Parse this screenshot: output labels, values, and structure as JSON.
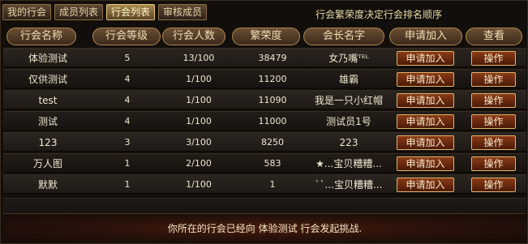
{
  "tabs": [
    {
      "label": "我的行会"
    },
    {
      "label": "成员列表"
    },
    {
      "label": "行会列表"
    },
    {
      "label": "审核成员"
    }
  ],
  "notice": "行会繁荣度决定行会排名顺序",
  "columns": {
    "name": "行会名称",
    "level": "行会等级",
    "members": "行会人数",
    "prosperity": "繁荣度",
    "leader": "会长名字",
    "apply": "申请加入",
    "view": "查看"
  },
  "rows": [
    {
      "name": "体验测试",
      "level": "5",
      "members": "13/100",
      "prosperity": "38479",
      "leader": "女乃嘴ᵀᴱᴸ",
      "apply": "申请加入",
      "op": "操作"
    },
    {
      "name": "仅供测试",
      "level": "4",
      "members": "1/100",
      "prosperity": "11200",
      "leader": "雄霸",
      "apply": "申请加入",
      "op": "操作"
    },
    {
      "name": "test",
      "level": "4",
      "members": "1/100",
      "prosperity": "11090",
      "leader": "我是一只小红帽",
      "apply": "申请加入",
      "op": "操作"
    },
    {
      "name": "测试",
      "level": "4",
      "members": "1/100",
      "prosperity": "11000",
      "leader": "测试员1号",
      "apply": "申请加入",
      "op": "操作"
    },
    {
      "name": "123",
      "level": "3",
      "members": "3/100",
      "prosperity": "8250",
      "leader": "223",
      "apply": "申请加入",
      "op": "操作"
    },
    {
      "name": "万人图",
      "level": "1",
      "members": "2/100",
      "prosperity": "583",
      "leader": "★...宝贝糟糟...",
      "apply": "申请加入",
      "op": "操作"
    },
    {
      "name": "默默",
      "level": "1",
      "members": "1/100",
      "prosperity": "1",
      "leader": "``...宝贝糟糟...",
      "apply": "申请加入",
      "op": "操作"
    }
  ],
  "message": "你所在的行会已经向 体验测试 行会发起挑战."
}
